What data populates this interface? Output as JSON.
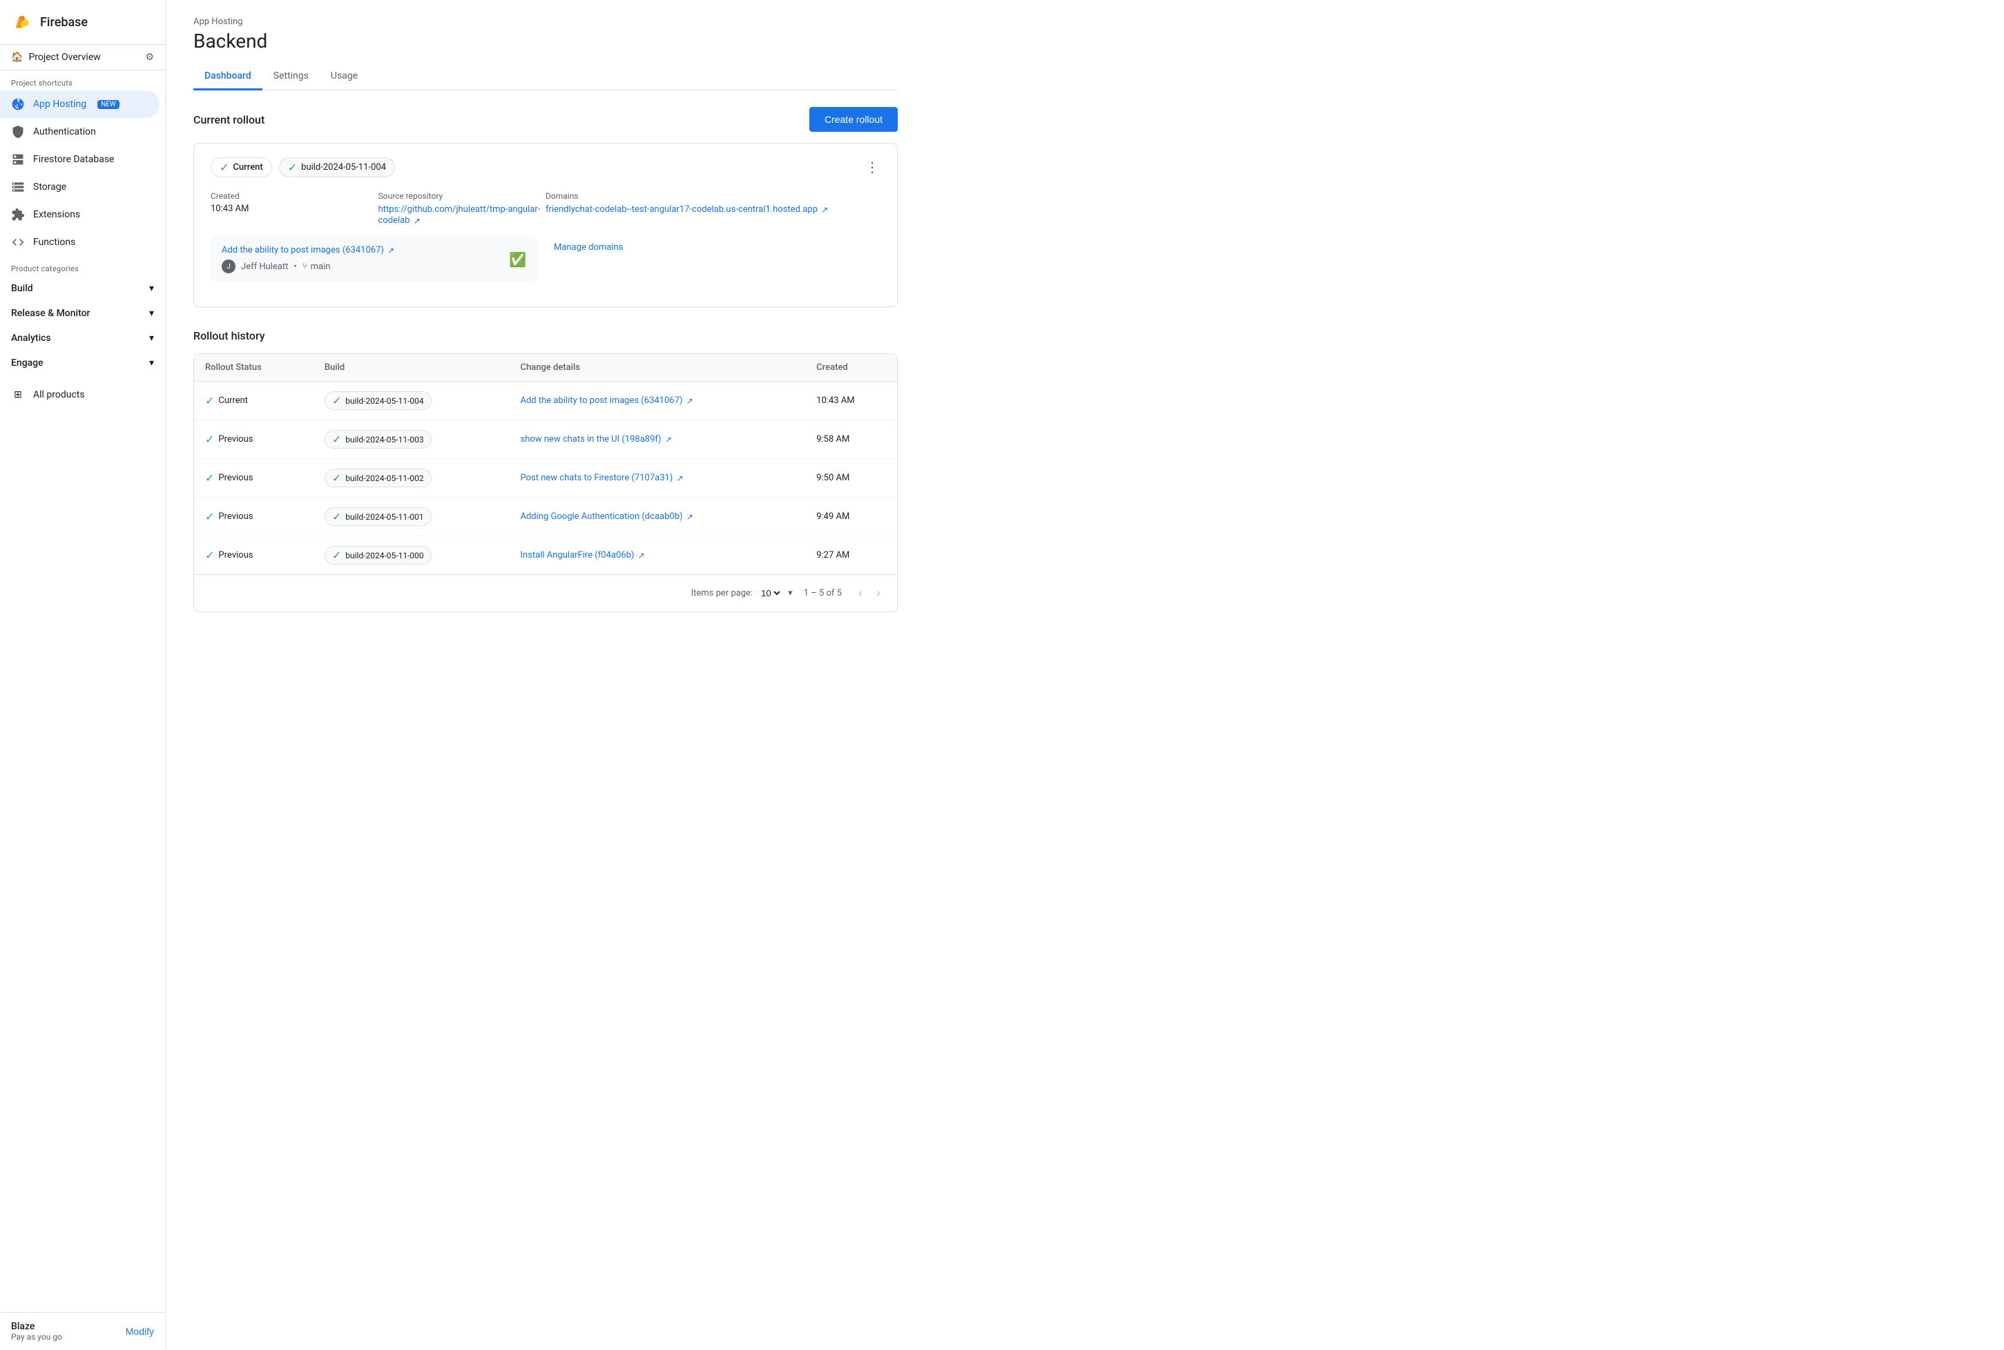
{
  "sidebar": {
    "app_name": "Firebase",
    "project_overview": "Project Overview",
    "shortcuts_label": "Project shortcuts",
    "nav_items": [
      {
        "id": "app-hosting",
        "label": "App Hosting",
        "badge": "NEW",
        "active": true
      },
      {
        "id": "authentication",
        "label": "Authentication",
        "active": false
      },
      {
        "id": "firestore",
        "label": "Firestore Database",
        "active": false
      },
      {
        "id": "storage",
        "label": "Storage",
        "active": false
      },
      {
        "id": "extensions",
        "label": "Extensions",
        "active": false
      },
      {
        "id": "functions",
        "label": "Functions",
        "active": false
      }
    ],
    "categories": [
      {
        "id": "build",
        "label": "Build"
      },
      {
        "id": "release-monitor",
        "label": "Release & Monitor"
      },
      {
        "id": "analytics",
        "label": "Analytics"
      },
      {
        "id": "engage",
        "label": "Engage"
      }
    ],
    "all_products": "All products",
    "plan": {
      "name": "Blaze",
      "sub": "Pay as you go",
      "modify": "Modify"
    }
  },
  "header": {
    "breadcrumb": "App Hosting",
    "title": "Backend",
    "tabs": [
      {
        "id": "dashboard",
        "label": "Dashboard",
        "active": true
      },
      {
        "id": "settings",
        "label": "Settings",
        "active": false
      },
      {
        "id": "usage",
        "label": "Usage",
        "active": false
      }
    ]
  },
  "current_rollout": {
    "section_title": "Current rollout",
    "create_btn": "Create rollout",
    "badge_current": "Current",
    "badge_build": "build-2024-05-11-004",
    "created_label": "Created",
    "created_value": "10:43 AM",
    "source_label": "Source repository",
    "source_link_text": "https://github.com/jhuleatt/tmp-angular-codelab",
    "source_link_url": "https://github.com/jhuleatt/tmp-angular-codelab",
    "domains_label": "Domains",
    "domain_link_text": "friendlychat-codelab--test-angular17-codelab.us-central1.hosted.app",
    "domain_link_url": "#",
    "commit_link_text": "Add the ability to post images (6341067)",
    "commit_link_url": "#",
    "author": "Jeff Huleatt",
    "branch": "main",
    "manage_domains": "Manage domains"
  },
  "rollout_history": {
    "title": "Rollout history",
    "columns": [
      "Rollout Status",
      "Build",
      "Change details",
      "Created"
    ],
    "rows": [
      {
        "status": "Current",
        "build": "build-2024-05-11-004",
        "change_text": "Add the ability to post images (6341067)",
        "change_url": "#",
        "created": "10:43 AM"
      },
      {
        "status": "Previous",
        "build": "build-2024-05-11-003",
        "change_text": "show new chats in the UI (198a89f)",
        "change_url": "#",
        "created": "9:58 AM"
      },
      {
        "status": "Previous",
        "build": "build-2024-05-11-002",
        "change_text": "Post new chats to Firestore (7107a31)",
        "change_url": "#",
        "created": "9:50 AM"
      },
      {
        "status": "Previous",
        "build": "build-2024-05-11-001",
        "change_text": "Adding Google Authentication (dcaab0b)",
        "change_url": "#",
        "created": "9:49 AM"
      },
      {
        "status": "Previous",
        "build": "build-2024-05-11-000",
        "change_text": "Install AngularFire (f04a06b)",
        "change_url": "#",
        "created": "9:27 AM"
      }
    ],
    "pagination": {
      "items_per_page_label": "Items per page:",
      "items_per_page_value": "10",
      "page_info": "1 – 5 of 5"
    }
  }
}
